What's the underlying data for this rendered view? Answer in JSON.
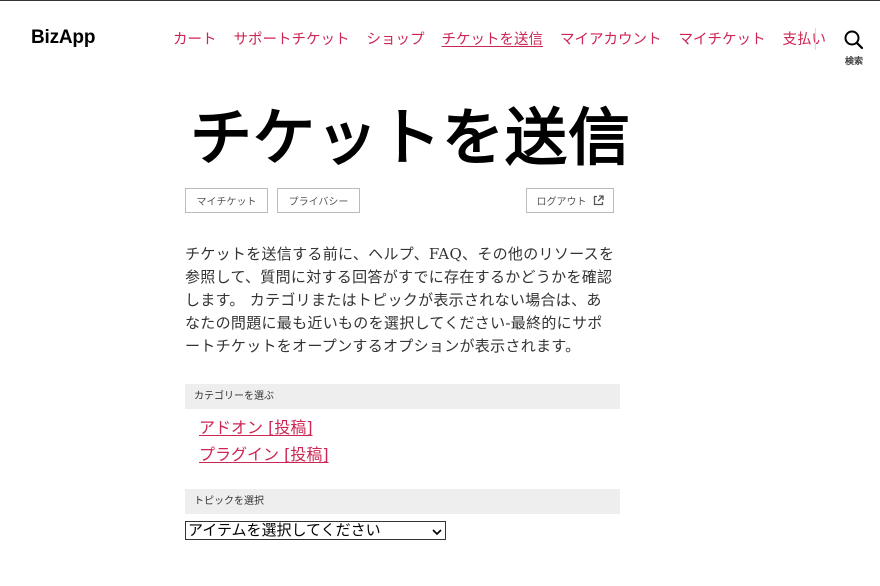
{
  "header": {
    "logo": "BizApp",
    "nav": [
      {
        "label": "カート"
      },
      {
        "label": "サポートチケット"
      },
      {
        "label": "ショップ"
      },
      {
        "label": "チケットを送信",
        "current": true
      },
      {
        "label": "マイアカウント"
      },
      {
        "label": "マイチケット"
      },
      {
        "label": "支払い"
      }
    ],
    "search_label": "検索",
    "search_icon": "search-icon"
  },
  "page": {
    "title": "チケットを送信",
    "buttons": {
      "my_tickets": "マイチケット",
      "privacy": "プライバシー",
      "logout": "ログアウト",
      "logout_icon": "external-link-icon"
    },
    "intro": "チケットを送信する前に、ヘルプ、FAQ、その他のリソースを参照して、質問に対する回答がすでに存在するかどうかを確認します。 カテゴリまたはトピックが表示されない場合は、あなたの問題に最も近いものを選択してください-最終的にサポートチケットをオープンするオプションが表示されます。",
    "category_heading": "カテゴリーを選ぶ",
    "categories": [
      {
        "label": "アドオン [投稿]"
      },
      {
        "label": "プラグイン [投稿]"
      }
    ],
    "topic_heading": "トピックを選択",
    "topic_select": {
      "value": "アイテムを選択してください"
    }
  },
  "colors": {
    "accent": "#cd2653",
    "section_bg": "#eeeeee"
  }
}
